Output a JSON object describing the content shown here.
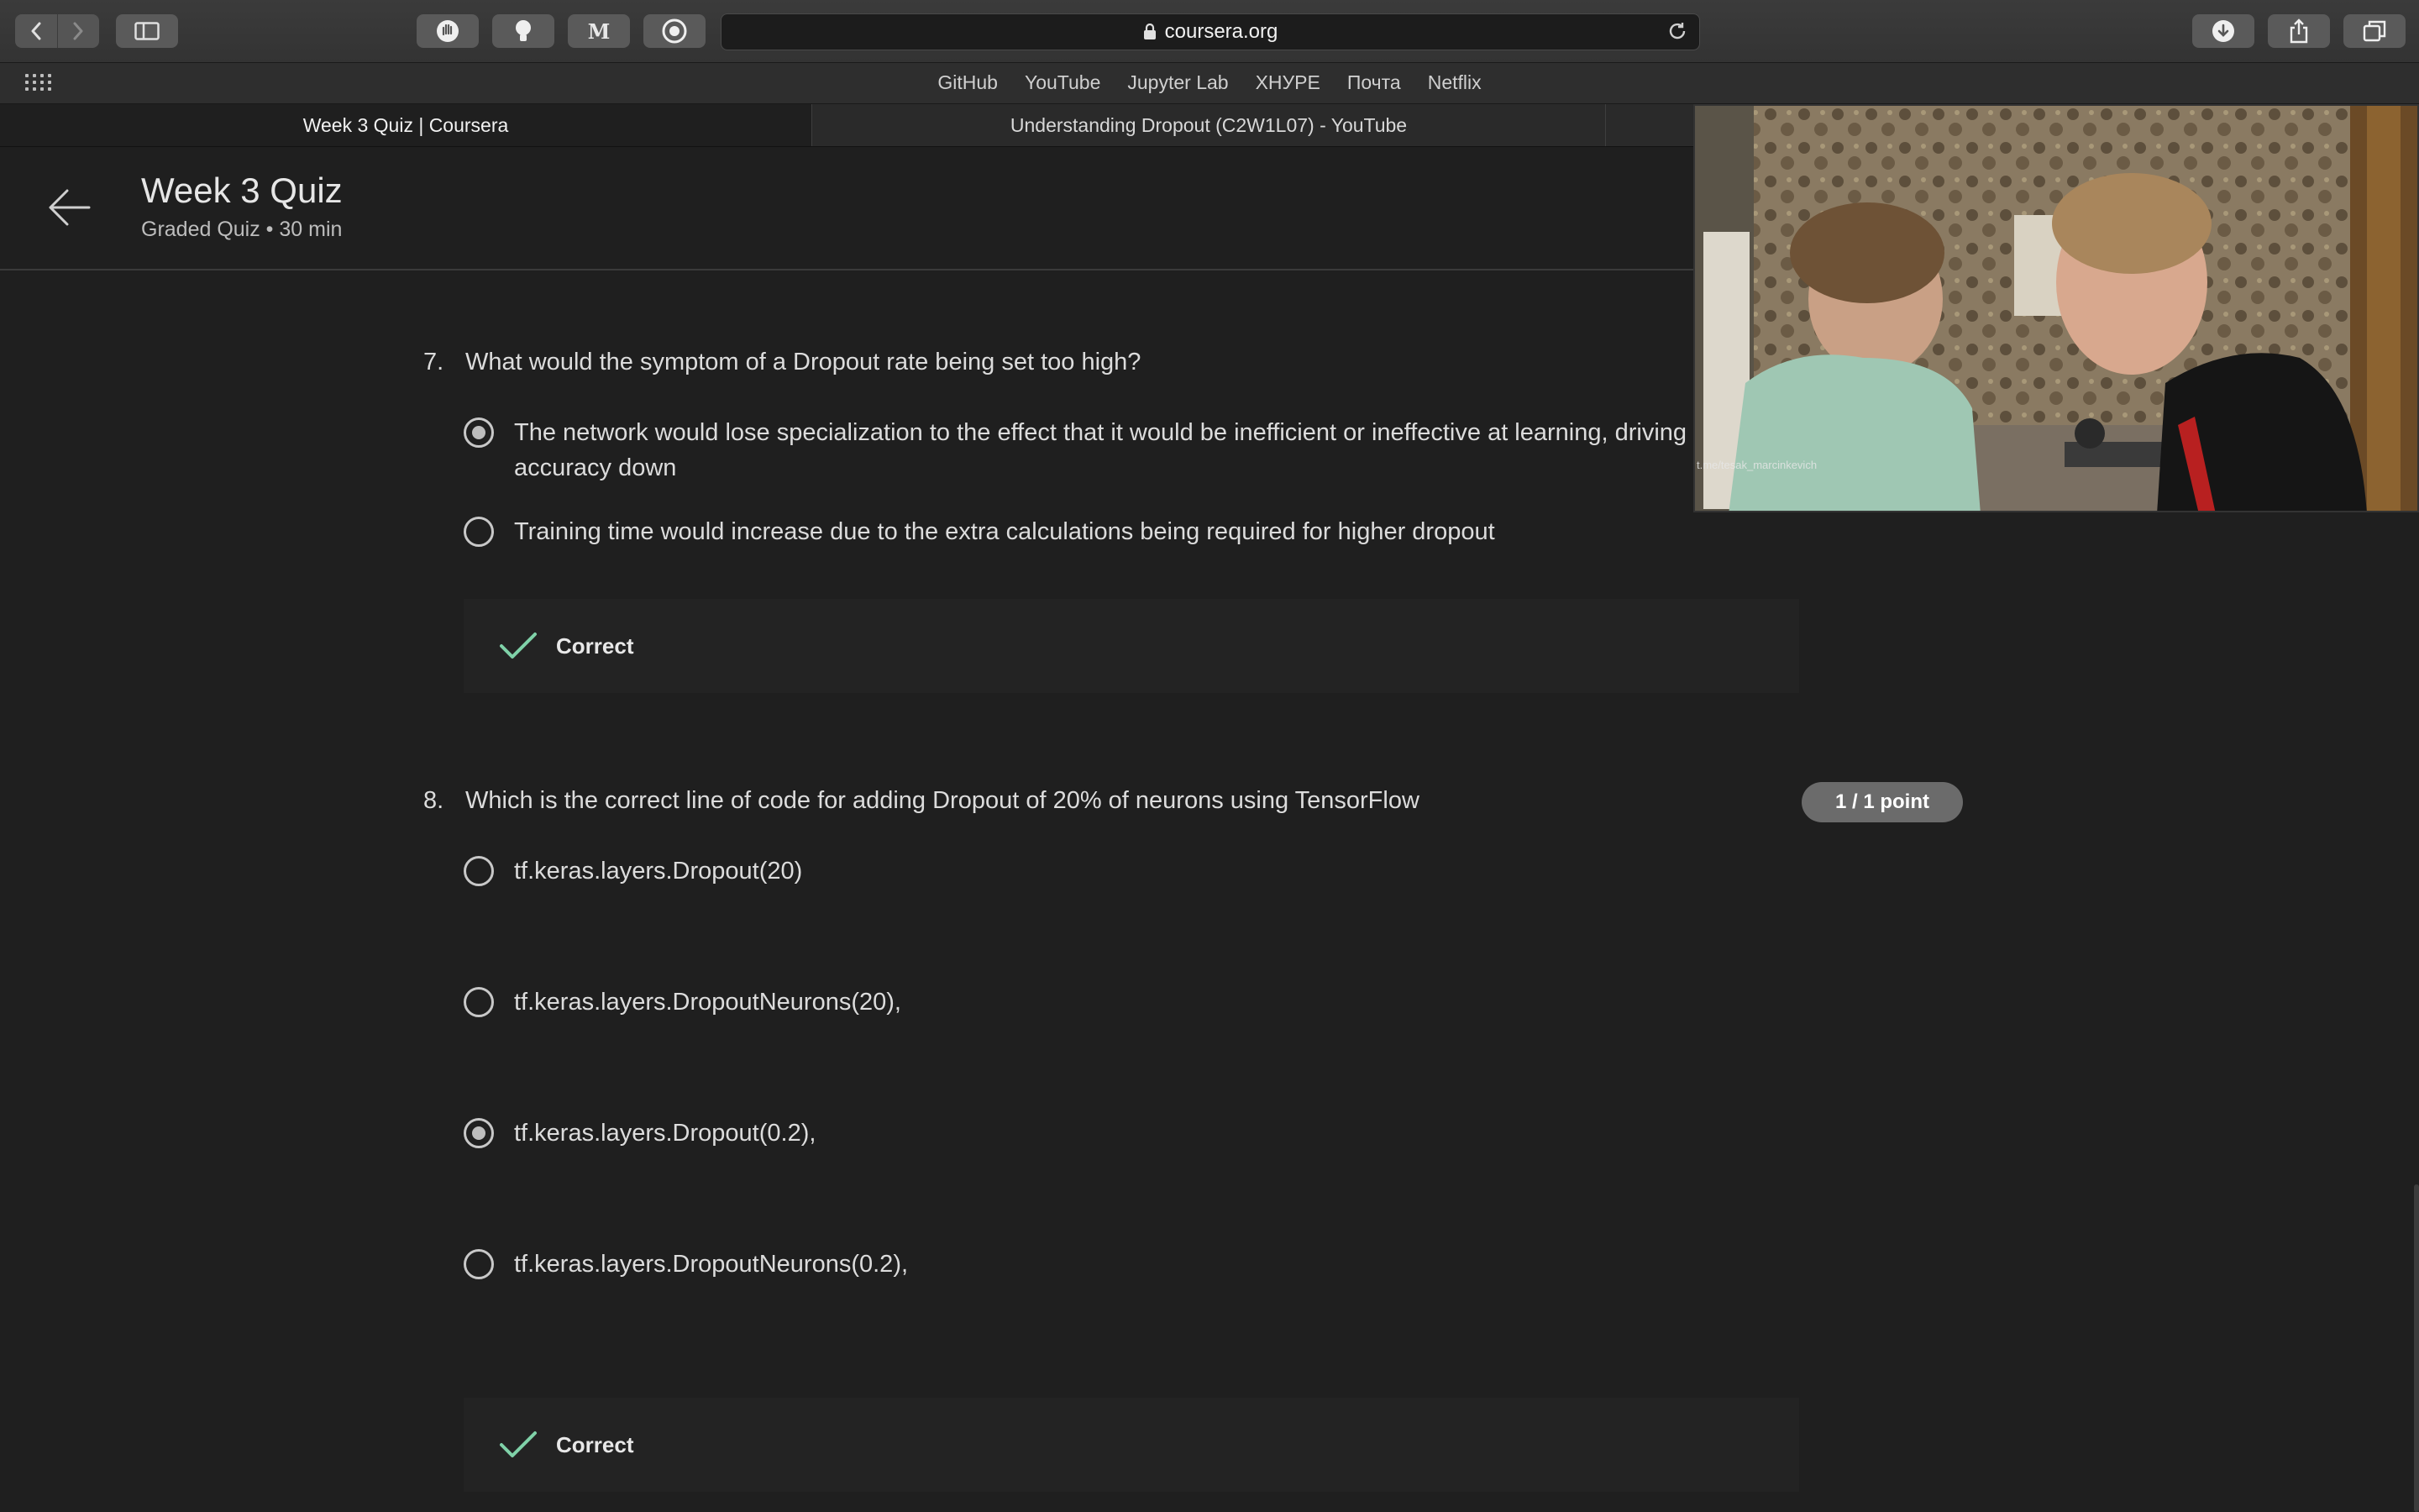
{
  "browser": {
    "url": "coursera.org",
    "bookmarks": [
      "GitHub",
      "YouTube",
      "Jupyter Lab",
      "ХНУРЕ",
      "Почта",
      "Netflix"
    ],
    "tabs": [
      {
        "label": "Week 3 Quiz | Coursera",
        "active": true
      },
      {
        "label": "Understanding Dropout (C2W1L07) - YouTube",
        "active": false
      }
    ],
    "extension_icons": [
      "hand-icon",
      "lightbulb-icon",
      "mendeley-icon",
      "camera-icon"
    ]
  },
  "header": {
    "title": "Week 3 Quiz",
    "subtitle": "Graded Quiz • 30 min"
  },
  "questions": [
    {
      "number": "7.",
      "text": "What would the symptom of a Dropout rate being set too high?",
      "options": [
        {
          "label": "The network would lose specialization to the effect that it would be inefficient or ineffective at learning, driving accuracy down",
          "selected": true
        },
        {
          "label": "Training time would increase due to the extra calculations being required for higher dropout",
          "selected": false
        }
      ],
      "feedback": "Correct"
    },
    {
      "number": "8.",
      "text": "Which is the correct line of code for adding Dropout of 20% of neurons using TensorFlow",
      "points": "1 / 1 point",
      "options": [
        {
          "label": "tf.keras.layers.Dropout(20)",
          "selected": false
        },
        {
          "label": "tf.keras.layers.DropoutNeurons(20),",
          "selected": false
        },
        {
          "label": "tf.keras.layers.Dropout(0.2),",
          "selected": true
        },
        {
          "label": "tf.keras.layers.DropoutNeurons(0.2),",
          "selected": false
        }
      ],
      "feedback": "Correct"
    }
  ],
  "video": {
    "watermark": "t.me/tesak_marcinkevich"
  },
  "colors": {
    "background": "#1f1f1f",
    "correct_check": "#7fd1a8",
    "badge": "#6b6b6b"
  }
}
